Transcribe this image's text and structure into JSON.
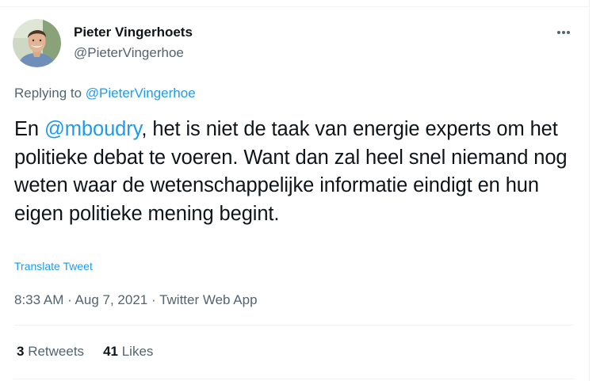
{
  "author": {
    "name": "Pieter Vingerhoets",
    "handle": "@PieterVingerhoe"
  },
  "reply": {
    "prefix": "Replying to ",
    "to": "@PieterVingerhoe"
  },
  "tweet": {
    "pre": "En ",
    "mention": "@mboudry",
    "text": ", het is niet de taak van energie experts om het politieke debat te voeren. Want dan zal heel snel niemand nog weten waar de wetenschappelijke informatie eindigt en hun eigen politieke mening begint."
  },
  "translate_label": "Translate Tweet",
  "meta": {
    "time": "8:33 AM",
    "date": "Aug 7, 2021",
    "source": "Twitter Web App",
    "separator": " · "
  },
  "stats": {
    "retweets_count": "3",
    "retweets_label": " Retweets",
    "likes_count": "41",
    "likes_label": " Likes"
  },
  "icons": {
    "more": "more-horizontal-icon",
    "avatar": "avatar"
  },
  "colors": {
    "link": "#1d9bf0",
    "secondary": "#536471",
    "primary": "#0f1419",
    "divider": "#eff3f4"
  }
}
